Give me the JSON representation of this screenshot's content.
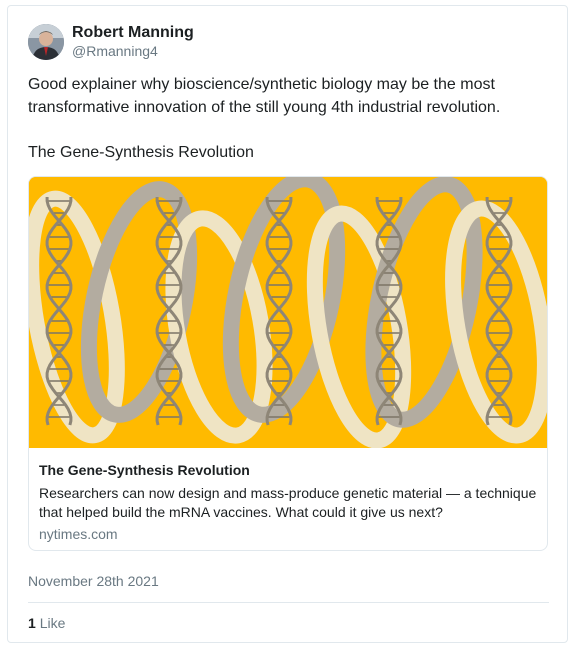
{
  "author": {
    "display_name": "Robert Manning",
    "handle": "@Rmanning4"
  },
  "tweet": {
    "text": "Good explainer why bioscience/synthetic biology may be the most transformative innovation of the still young 4th industrial revolution.\n\nThe Gene-Synthesis Revolution"
  },
  "card": {
    "title": "The Gene-Synthesis Revolution",
    "description": "Researchers can now design and mass-produce genetic material — a technique that helped build the mRNA vaccines. What could it give us next?",
    "domain": "nytimes.com"
  },
  "meta": {
    "date": "November 28th 2021",
    "like_count": "1",
    "like_label": "Like"
  },
  "colors": {
    "card_image_background": "#ffba00",
    "ribbon": "#efe4c4",
    "ribbon_shade": "#b3aca0",
    "link_gray": "#697882"
  }
}
